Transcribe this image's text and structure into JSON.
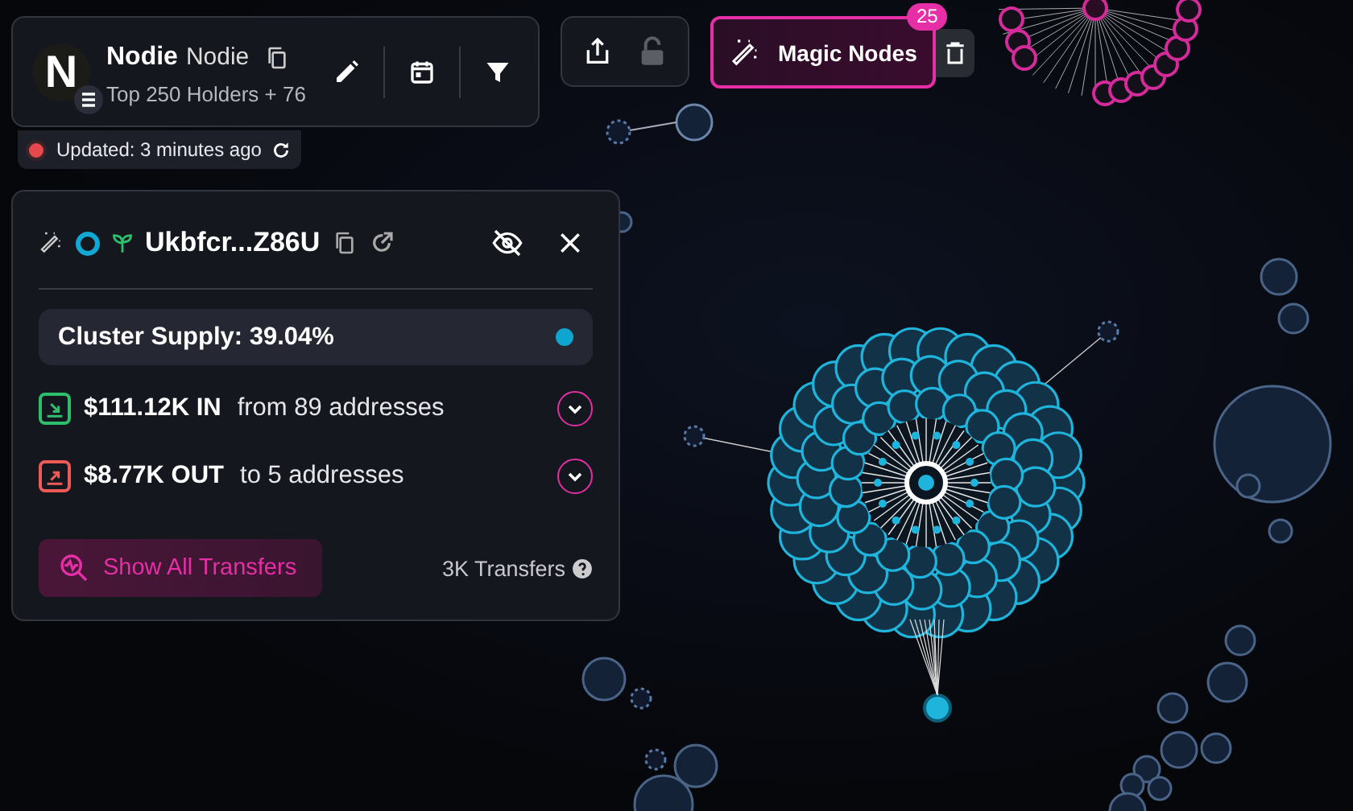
{
  "header": {
    "logo": "N",
    "name": "Nodie",
    "symbol": "Nodie",
    "subtitle": "Top 250 Holders + 76"
  },
  "updated": {
    "text": "Updated: 3 minutes ago",
    "color": "#e5484d"
  },
  "toolbar": [
    {
      "kind": "share",
      "disabled": false
    },
    {
      "kind": "lock",
      "disabled": true
    }
  ],
  "magic_nodes": {
    "label": "Magic Nodes",
    "badge": "25",
    "selected": true
  },
  "panel": {
    "address": "Ukbfcr...Z86U",
    "supply": "Cluster Supply: 39.04%",
    "color": "#0ea5d0",
    "flows": [
      {
        "kind": "in",
        "amount": "$111.12K IN",
        "detail": "from 89 addresses",
        "expanded": false
      },
      {
        "kind": "out",
        "amount": "$8.77K OUT",
        "detail": "to 5 addresses",
        "expanded": false
      }
    ],
    "button": "Show All Transfers",
    "transfers": "3K Transfers"
  }
}
